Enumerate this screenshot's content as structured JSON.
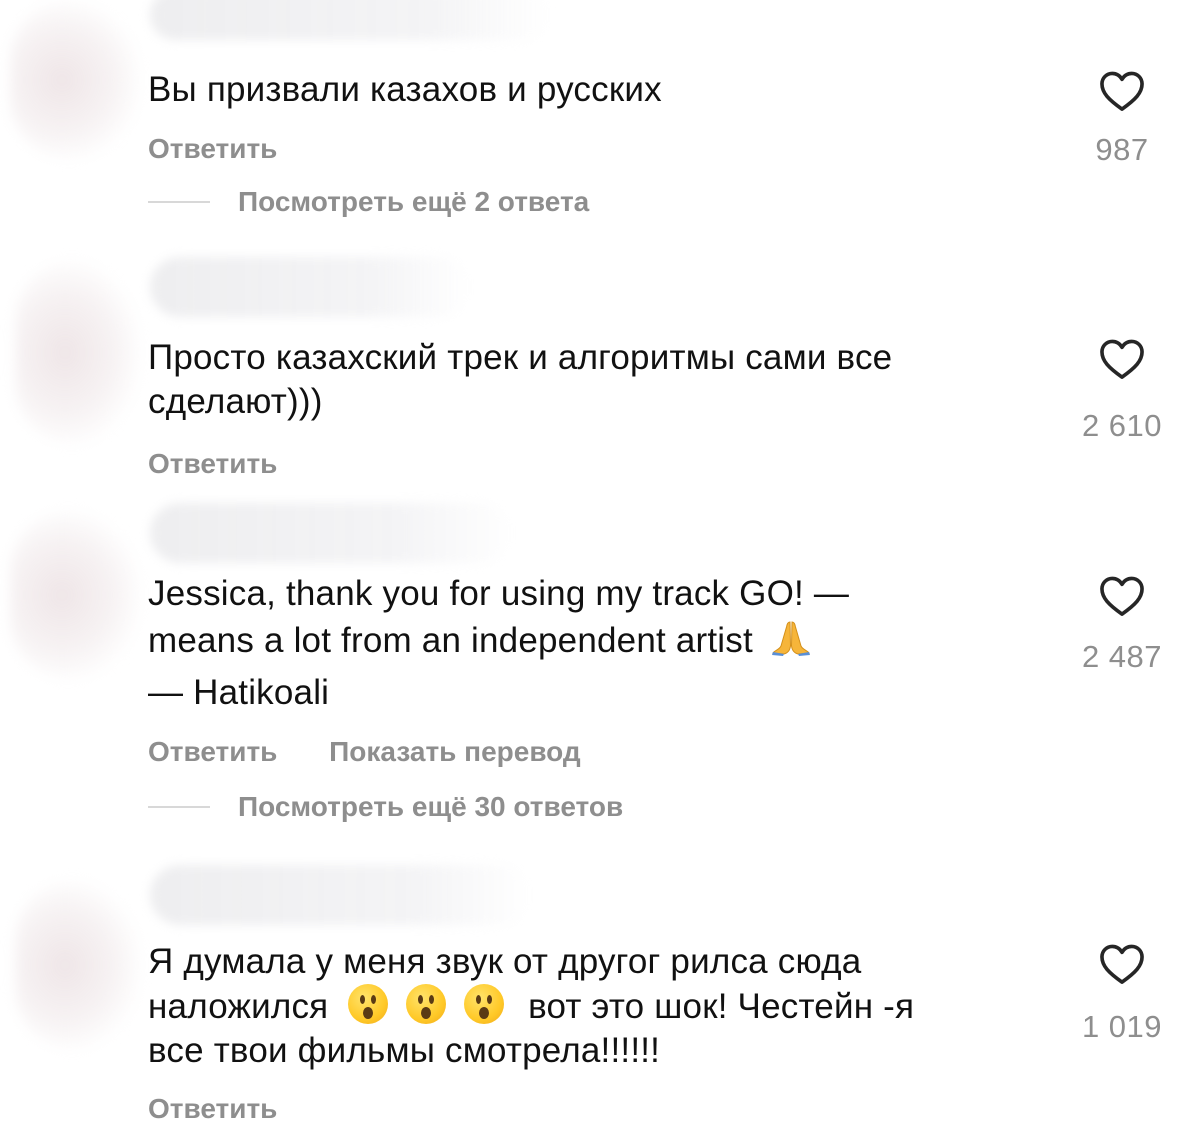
{
  "comments": [
    {
      "text_lines": [
        "Вы призвали казахов и русских"
      ],
      "actions": [
        "Ответить"
      ],
      "replies": "Посмотреть ещё 2 ответа",
      "likes": "987"
    },
    {
      "text_lines": [
        "Просто казахский трек и алгоритмы сами все",
        "сделают)))"
      ],
      "actions": [
        "Ответить"
      ],
      "likes": "2 610"
    },
    {
      "text_lines": [
        "Jessica, thank you for using my track GO! —",
        "means a lot from an independent artist",
        "— Hatikoali"
      ],
      "actions": [
        "Ответить",
        "Показать перевод"
      ],
      "replies": "Посмотреть ещё 30 ответов",
      "likes": "2 487",
      "emoji": "folded-hands"
    },
    {
      "text_lines": [
        "Я думала у меня звук от другог рилса сюда",
        "наложился",
        "вот это шок! Честейн -я",
        "все твои фильмы смотрела!!!!!!"
      ],
      "actions": [
        "Ответить"
      ],
      "likes": "1 019",
      "emoji": "astonished-face"
    }
  ],
  "icons": {
    "like": "heart-outline-icon"
  },
  "colors": {
    "text": "#111111",
    "muted": "#8e8e8e",
    "heart": "#262626"
  }
}
